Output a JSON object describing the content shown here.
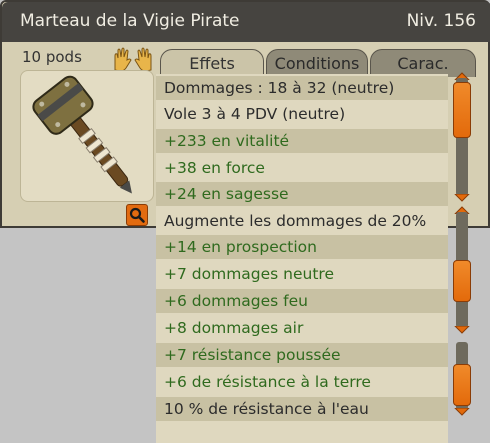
{
  "item": {
    "name": "Marteau de la Vigie Pirate",
    "level": "Niv. 156",
    "weight": "10 pods"
  },
  "tabs": [
    {
      "label": "Effets",
      "active": true
    },
    {
      "label": "Conditions",
      "active": false
    },
    {
      "label": "Carac.",
      "active": false
    }
  ],
  "effects": [
    {
      "text": "Dommages : 18 à 32 (neutre)",
      "color": "dark"
    },
    {
      "text": "Vole 3 à 4 PDV (neutre)",
      "color": "dark"
    },
    {
      "text": "+233 en vitalité",
      "color": "green"
    },
    {
      "text": "+38 en force",
      "color": "green"
    },
    {
      "text": "+24 en sagesse",
      "color": "green"
    },
    {
      "text": "Augmente les dommages de 20%",
      "color": "dark"
    },
    {
      "text": "+14 en prospection",
      "color": "green"
    },
    {
      "text": "+7 dommages neutre",
      "color": "green"
    },
    {
      "text": "+6 dommages feu",
      "color": "green"
    },
    {
      "text": "+8 dommages air",
      "color": "green"
    },
    {
      "text": "+7 résistance poussée",
      "color": "green"
    },
    {
      "text": "+6 de résistance à la terre",
      "color": "green"
    },
    {
      "text": "10 % de résistance à l'eau",
      "color": "dark"
    }
  ],
  "colors": {
    "accent": "#e36a0b",
    "green_text": "#2f6a1e",
    "titlebar": "#464440"
  },
  "icons": [
    "hands-icon",
    "hammer-item-icon",
    "search-icon",
    "scroll-up-icon",
    "scroll-down-icon"
  ]
}
